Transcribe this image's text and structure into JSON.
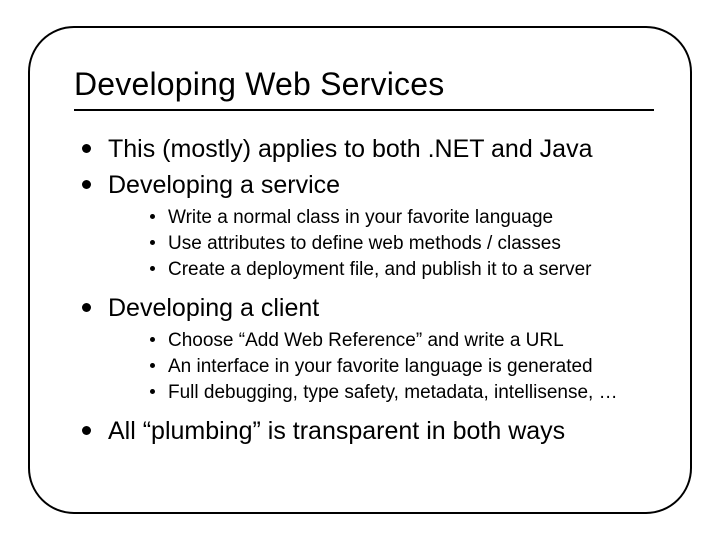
{
  "title": "Developing Web Services",
  "points": {
    "p0": "This (mostly) applies to both .NET and Java",
    "p1": "Developing a service",
    "p1_sub": {
      "s0": "Write a normal class in your favorite language",
      "s1": "Use attributes to define web methods / classes",
      "s2": "Create a deployment file, and publish it to a server"
    },
    "p2": "Developing a client",
    "p2_sub": {
      "s0": "Choose “Add Web Reference” and write a URL",
      "s1": "An interface in your favorite language is generated",
      "s2": "Full debugging, type safety, metadata, intellisense, …"
    },
    "p3": "All “plumbing” is transparent in both ways"
  }
}
